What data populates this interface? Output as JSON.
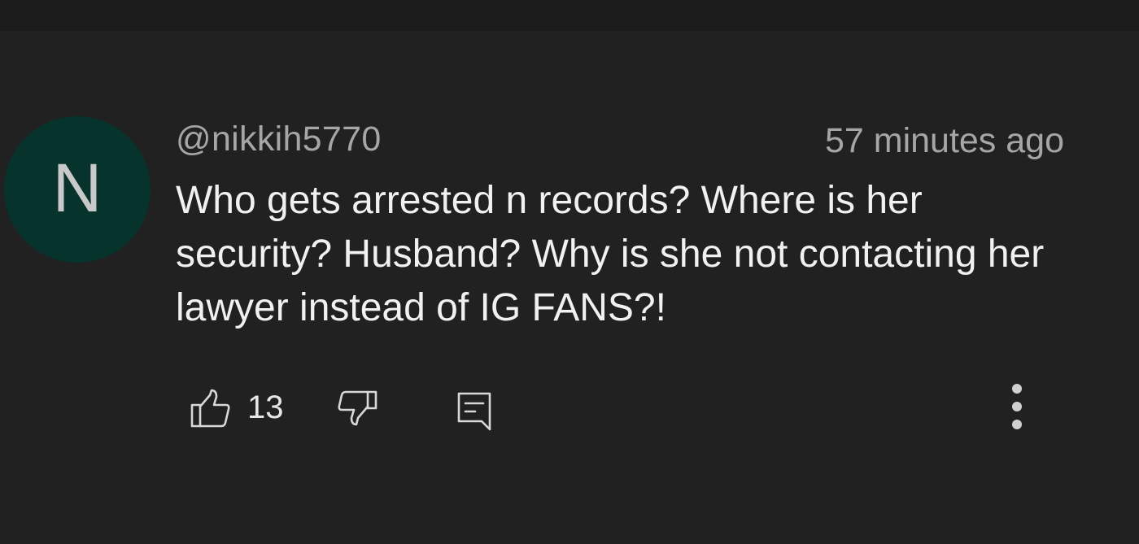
{
  "comment": {
    "author": {
      "handle": "@nikkih5770",
      "avatar_letter": "N",
      "avatar_color": "#07332d"
    },
    "timestamp": "57 minutes ago",
    "text": "Who gets arrested n records? Where is her security? Husband? Why is she not contacting her lawyer instead of IG FANS?!",
    "actions": {
      "like_count": "13",
      "like_icon": "thumbs-up-icon",
      "dislike_icon": "thumbs-down-icon",
      "reply_icon": "comment-reply-icon",
      "more_icon": "more-vertical-icon"
    }
  },
  "colors": {
    "background": "#212121",
    "primary_text": "#f1f1f1",
    "secondary_text": "#a6a6a6"
  }
}
